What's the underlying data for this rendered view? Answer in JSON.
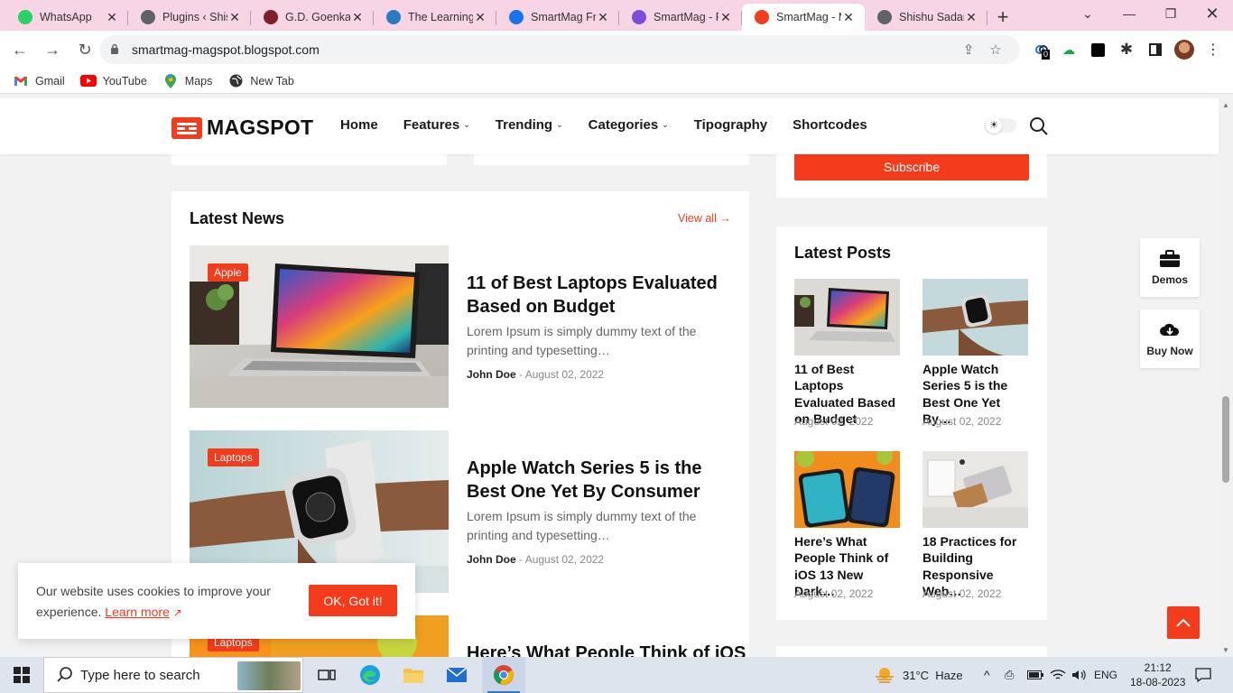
{
  "browser": {
    "tabs": [
      {
        "title": "WhatsApp",
        "icon": "whatsapp-icon",
        "color": "#25d366"
      },
      {
        "title": "Plugins ‹ Shis",
        "icon": "wordpress-icon",
        "color": "#5f6368"
      },
      {
        "title": "G.D. Goenka P",
        "icon": "school-crest-icon",
        "color": "#7a1f2b"
      },
      {
        "title": "The Learning",
        "icon": "learning-icon",
        "color": "#2b7bbf"
      },
      {
        "title": "SmartMag Fre",
        "icon": "blogger-icon",
        "color": "#1a73e8"
      },
      {
        "title": "SmartMag - F",
        "icon": "form-icon",
        "color": "#7c4ddb"
      },
      {
        "title": "SmartMag - M",
        "icon": "magspot-icon",
        "color": "#f43b1b",
        "active": true
      },
      {
        "title": "Shishu Sadan",
        "icon": "globe-icon",
        "color": "#5f6368"
      }
    ],
    "url": "smartmag-magspot.blogspot.com",
    "bookmarks": [
      {
        "label": "Gmail",
        "icon": "gmail-icon"
      },
      {
        "label": "YouTube",
        "icon": "youtube-icon"
      },
      {
        "label": "Maps",
        "icon": "maps-icon"
      },
      {
        "label": "New Tab",
        "icon": "globe-icon"
      }
    ],
    "extension_badge": "0"
  },
  "site": {
    "brand": "MAGSPOT",
    "accent": "#f43b1b",
    "nav": [
      {
        "label": "Home",
        "dropdown": false
      },
      {
        "label": "Features",
        "dropdown": true
      },
      {
        "label": "Trending",
        "dropdown": true
      },
      {
        "label": "Categories",
        "dropdown": true
      },
      {
        "label": "Tipography",
        "dropdown": false
      },
      {
        "label": "Shortcodes",
        "dropdown": false
      }
    ],
    "subscribe_label": "Subscribe",
    "latest_news": {
      "title": "Latest News",
      "view_all": "View all",
      "posts": [
        {
          "badge": "Apple",
          "title": "11 of Best Laptops Evaluated Based on Budget",
          "excerpt": "Lorem Ipsum is simply dummy text of the printing and typesetting…",
          "author": "John Doe",
          "date": "August 02, 2022"
        },
        {
          "badge": "Laptops",
          "title": "Apple Watch Series 5 is the Best One Yet By Consumer",
          "excerpt": "Lorem Ipsum is simply dummy text of the printing and typesetting…",
          "author": "John Doe",
          "date": "August 02, 2022"
        },
        {
          "badge": "Laptops",
          "title": "Here’s What People Think of iOS",
          "excerpt": "",
          "author": "",
          "date": ""
        }
      ]
    },
    "latest_posts": {
      "title": "Latest Posts",
      "posts": [
        {
          "title": "11 of Best Laptops Evaluated Based on Budget",
          "date": "August 02, 2022"
        },
        {
          "title": "Apple Watch Series 5 is the Best One Yet By…",
          "date": "August 02, 2022"
        },
        {
          "title": "Here’s What People Think of iOS 13 New Dark…",
          "date": "August 02, 2022"
        },
        {
          "title": "18 Practices for Building Responsive Web…",
          "date": "August 02, 2022"
        }
      ]
    },
    "side_buttons": [
      {
        "label": "Demos",
        "icon": "briefcase-icon"
      },
      {
        "label": "Buy Now",
        "icon": "cloud-download-icon"
      }
    ],
    "cookie": {
      "message": "Our website uses cookies to improve your experience.",
      "learn_more": "Learn more",
      "ok": "OK, Got it!"
    }
  },
  "taskbar": {
    "search_placeholder": "Type here to search",
    "weather": "31°C  Haze",
    "language": "ENG",
    "time": "21:12",
    "date": "18-08-2023"
  }
}
